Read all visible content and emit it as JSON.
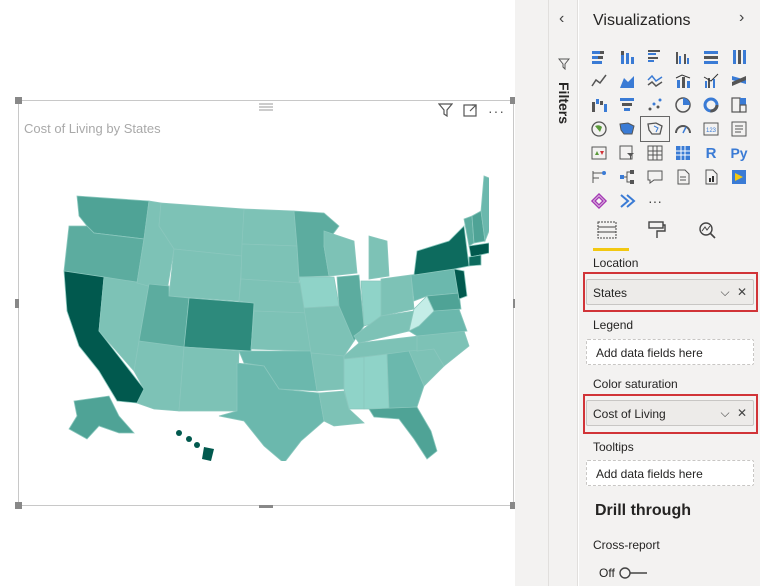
{
  "visual": {
    "title": "Cost of Living by States",
    "icons": [
      "filter-icon",
      "focus-mode-icon",
      "more-options-icon"
    ],
    "map_colors": {
      "light": "#8fd3c8",
      "mid": "#6bb8ad",
      "dark": "#2d8a7c",
      "darkest": "#01594e"
    }
  },
  "filters": {
    "label": "Filters"
  },
  "panel": {
    "title": "Visualizations",
    "tabs": [
      "fields-tab",
      "format-tab",
      "analytics-tab"
    ],
    "location_label": "Location",
    "location_value": "States",
    "legend_label": "Legend",
    "legend_placeholder": "Add data fields here",
    "saturation_label": "Color saturation",
    "saturation_value": "Cost of Living",
    "tooltips_label": "Tooltips",
    "tooltips_placeholder": "Add data fields here",
    "drill_title": "Drill through",
    "cross_report_label": "Cross-report",
    "toggle_label": "Off",
    "ellipsis": "···"
  }
}
